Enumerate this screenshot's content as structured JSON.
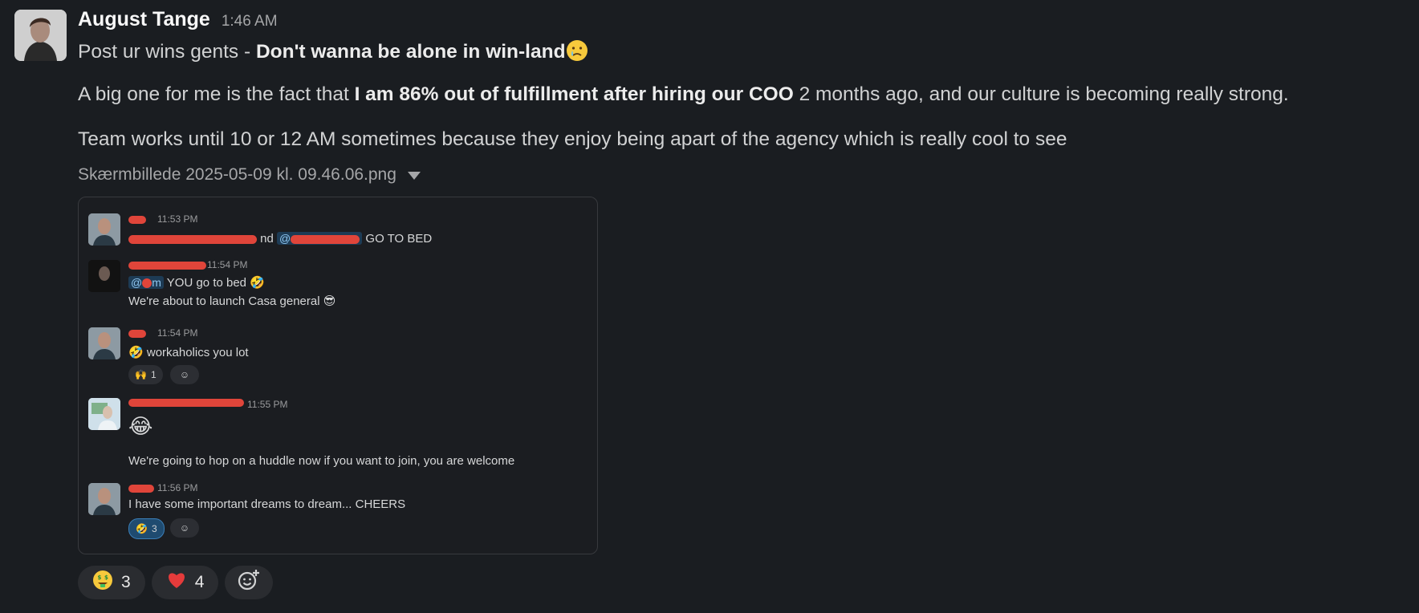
{
  "message": {
    "author": "August Tange",
    "time": "1:46 AM",
    "line1_prefix": "Post ur wins gents - ",
    "line1_bold": "Don't wanna be alone in win-land",
    "line2_prefix": "A big one for me is the fact that ",
    "line2_bold": "I am 86% out of fulfillment after hiring our COO",
    "line2_suffix": " 2 months ago, and our culture is becoming really strong.",
    "line3": "Team works until 10 or 12 AM sometimes because they enjoy being apart of the agency which is really cool to see",
    "attachment_name": "Skærmbillede 2025-05-09 kl. 09.46.06.png"
  },
  "preview": {
    "messages": [
      {
        "time": "11:53 PM",
        "text_mid": "nd",
        "mention": "@",
        "text_end": "GO TO BED"
      },
      {
        "time": "11:54 PM",
        "mention": "@",
        "text": "YOU go to bed",
        "text2": "We're about to launch Casa general"
      },
      {
        "time": "11:54 PM",
        "text": "workaholics you lot",
        "reaction_count": "1"
      },
      {
        "time": "11:55 PM",
        "text": "We're going to hop on a huddle now if you want to join, you are welcome"
      },
      {
        "time": "11:56 PM",
        "text": "I have some important dreams to dream... CHEERS",
        "reaction_count": "3"
      }
    ]
  },
  "reactions": [
    {
      "emoji": "money-mouth-face",
      "count": "3"
    },
    {
      "emoji": "red-heart",
      "count": "4"
    }
  ],
  "colors": {
    "background": "#1a1d21",
    "redaction": "#e0453a"
  }
}
